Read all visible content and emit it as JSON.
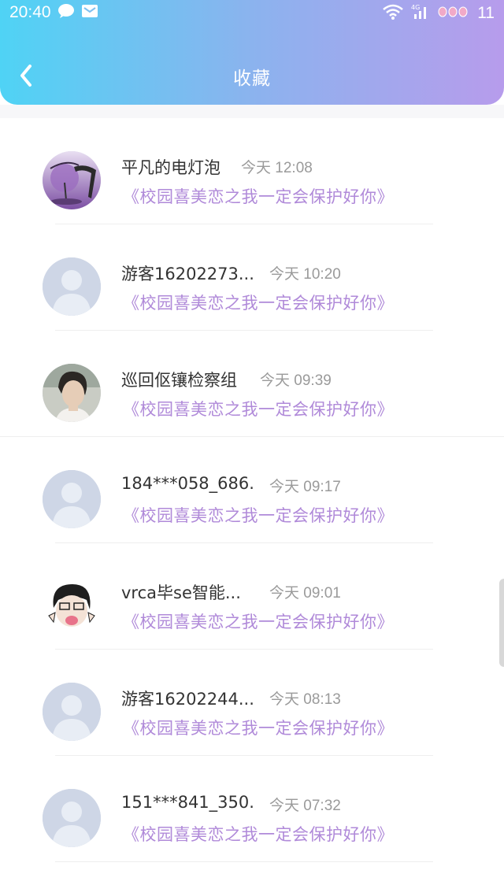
{
  "statusbar": {
    "time": "20:40",
    "network": "4G",
    "level": "11"
  },
  "header": {
    "title": "收藏",
    "back_icon": "chevron-left-icon"
  },
  "favorites": [
    {
      "user": "平凡的电灯泡",
      "time": "今天 12:08",
      "work": "《校园喜美恋之我一定会保护好你》",
      "avatar": "photo-purple"
    },
    {
      "user": "游客16202273...",
      "time": "今天 10:20",
      "work": "《校园喜美恋之我一定会保护好你》",
      "avatar": "default"
    },
    {
      "user": "巡回伛镶检察组",
      "time": "今天 09:39",
      "work": "《校园喜美恋之我一定会保护好你》",
      "avatar": "photo-man"
    },
    {
      "user": "184***058_686...",
      "time": "今天 09:17",
      "work": "《校园喜美恋之我一定会保护好你》",
      "avatar": "default"
    },
    {
      "user": "vrca毕se智能...",
      "time": "今天 09:01",
      "work": "《校园喜美恋之我一定会保护好你》",
      "avatar": "cartoon"
    },
    {
      "user": "游客16202244...",
      "time": "今天 08:13",
      "work": "《校园喜美恋之我一定会保护好你》",
      "avatar": "default"
    },
    {
      "user": "151***841_350...",
      "time": "今天 07:32",
      "work": "《校园喜美恋之我一定会保护好你》",
      "avatar": "default"
    }
  ],
  "colors": {
    "header_start": "#4fd3f5",
    "header_end": "#b79cec",
    "work_title": "#b08ad9",
    "time_text": "#9a9a9a"
  }
}
